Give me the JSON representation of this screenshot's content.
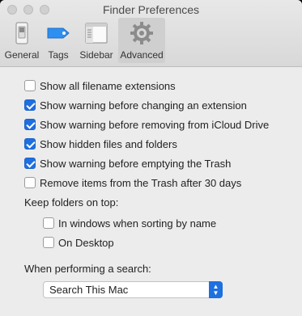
{
  "window": {
    "title": "Finder Preferences"
  },
  "toolbar": {
    "tabs": [
      {
        "label": "General",
        "icon": "general-switch-icon",
        "selected": false
      },
      {
        "label": "Tags",
        "icon": "tag-icon",
        "selected": false
      },
      {
        "label": "Sidebar",
        "icon": "sidebar-icon",
        "selected": false
      },
      {
        "label": "Advanced",
        "icon": "gear-icon",
        "selected": true
      }
    ]
  },
  "options": {
    "show_extensions": {
      "label": "Show all filename extensions",
      "checked": false
    },
    "warn_extension_change": {
      "label": "Show warning before changing an extension",
      "checked": true
    },
    "warn_icloud_remove": {
      "label": "Show warning before removing from iCloud Drive",
      "checked": true
    },
    "show_hidden": {
      "label": "Show hidden files and folders",
      "checked": true
    },
    "warn_empty_trash": {
      "label": "Show warning before emptying the Trash",
      "checked": true
    },
    "remove_trash_30": {
      "label": "Remove items from the Trash after 30 days",
      "checked": false
    }
  },
  "keep_folders": {
    "heading": "Keep folders on top:",
    "in_windows": {
      "label": "In windows when sorting by name",
      "checked": false
    },
    "on_desktop": {
      "label": "On Desktop",
      "checked": false
    }
  },
  "search": {
    "heading": "When performing a search:",
    "selected": "Search This Mac"
  },
  "colors": {
    "accent": "#1e6fe0",
    "window_bg": "#ececec"
  }
}
